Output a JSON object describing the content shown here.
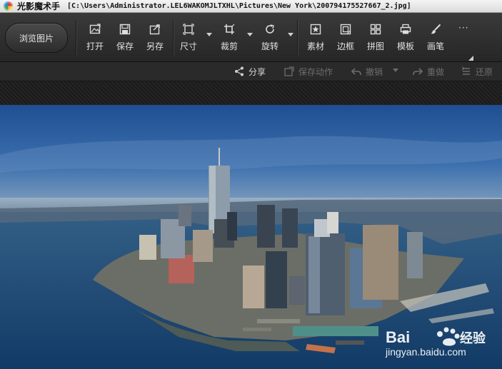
{
  "window": {
    "app_name": "光影魔术手",
    "file_path": "[C:\\Users\\Administrator.LEL6WAKOMJLTXHL\\Pictures\\New York\\200794175527667_2.jpg]"
  },
  "toolbar": {
    "browse_label": "浏览图片",
    "open_label": "打开",
    "save_label": "保存",
    "save_as_label": "另存",
    "size_label": "尺寸",
    "crop_label": "裁剪",
    "rotate_label": "旋转",
    "material_label": "素材",
    "border_label": "边框",
    "collage_label": "拼图",
    "template_label": "模板",
    "brush_label": "画笔",
    "more_label": "···"
  },
  "actions": {
    "share_label": "分享",
    "save_action_label": "保存动作",
    "undo_label": "撤销",
    "redo_label": "重做",
    "restore_label": "还原"
  },
  "watermark": {
    "brand_prefix": "Bai",
    "brand_suffix": "经验",
    "url": "jingyan.baidu.com"
  },
  "colors": {
    "toolbar_bg": "#2f2f2f",
    "enabled_text": "#d8d8d8",
    "disabled_text": "#6d6d6d",
    "sky": "#2a5a99",
    "water": "#1d4c7d"
  }
}
